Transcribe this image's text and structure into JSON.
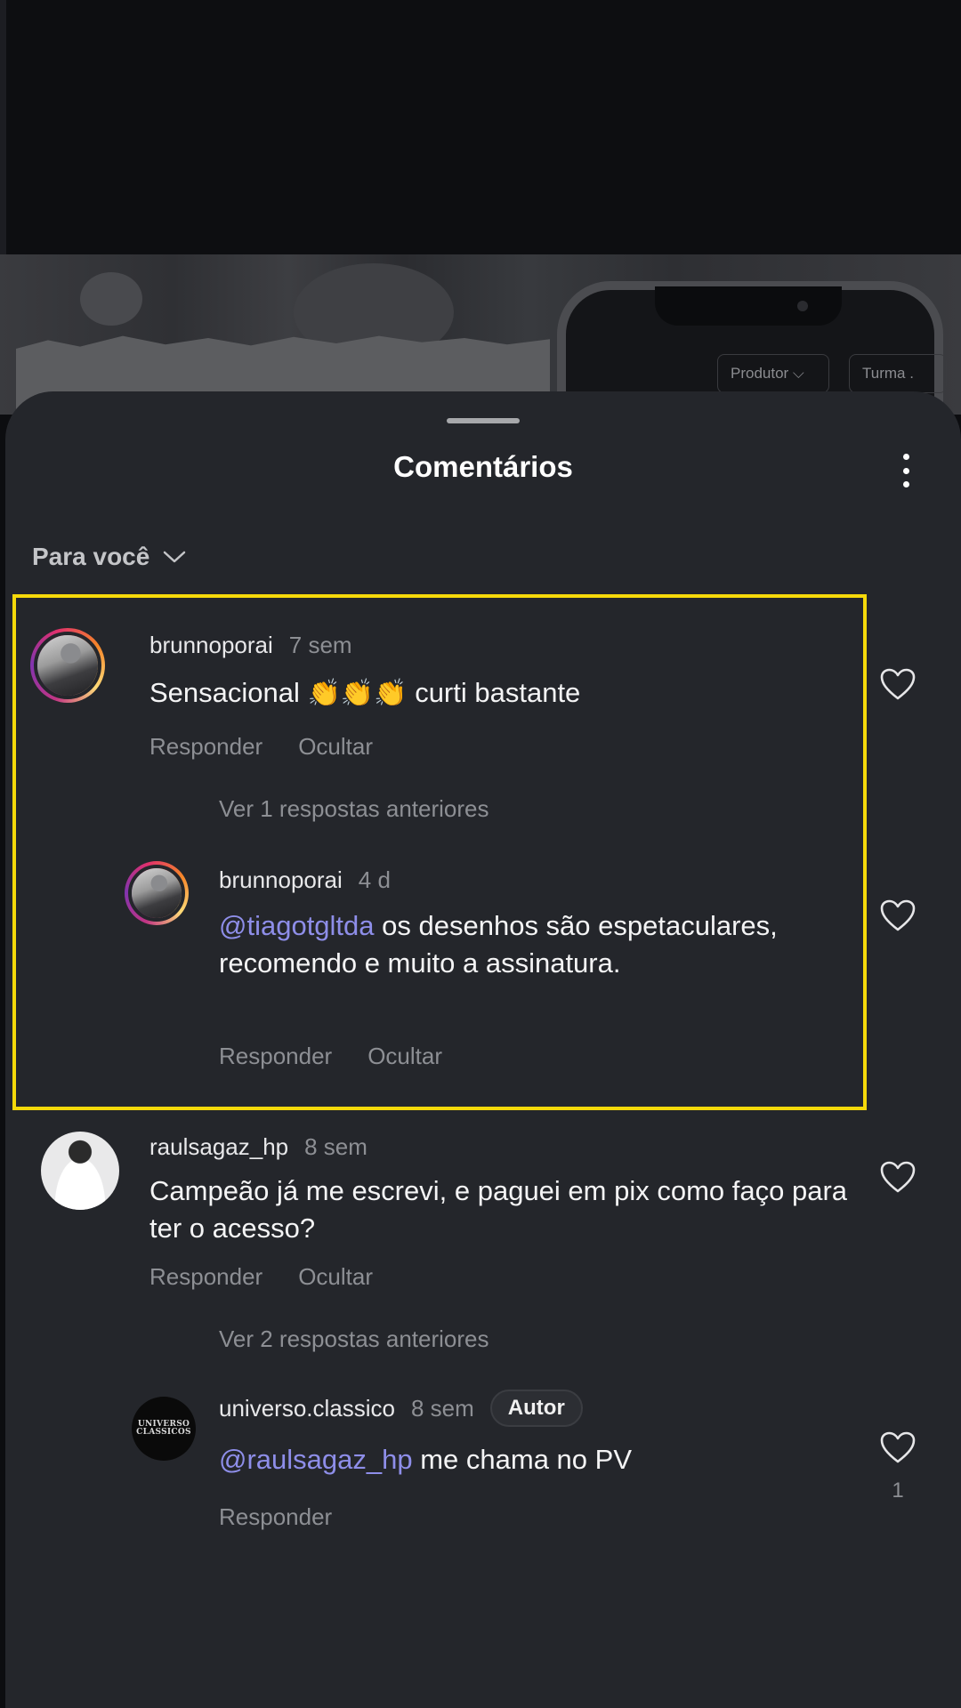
{
  "background": {
    "pill_produtor": "Produtor ⌵",
    "pill_turma": "Turma ."
  },
  "sheet": {
    "title": "Comentários",
    "filter_label": "Para você"
  },
  "comments": [
    {
      "username": "brunnoporai",
      "time": "7 sem",
      "text_before": "Sensacional ",
      "emoji": "👏👏👏",
      "text_after": " curti bastante",
      "reply_label": "Responder",
      "hide_label": "Ocultar",
      "view_replies": "Ver 1 respostas anteriores",
      "reply": {
        "username": "brunnoporai",
        "time": "4 d",
        "mention": "@tiagotgltda",
        "text": " os desenhos são espetaculares, recomendo e muito a assinatura.",
        "reply_label": "Responder",
        "hide_label": "Ocultar"
      }
    },
    {
      "username": "raulsagaz_hp",
      "time": "8 sem",
      "text": "Campeão já me escrevi,  e paguei em pix como faço para ter o acesso?",
      "reply_label": "Responder",
      "hide_label": "Ocultar",
      "view_replies": "Ver 2 respostas anteriores",
      "reply": {
        "username": "universo.classico",
        "time": "8 sem",
        "badge": "Autor",
        "mention": "@raulsagaz_hp",
        "text": " me chama no PV",
        "reply_label": "Responder",
        "like_count": "1",
        "avatar_logo_line1": "UNIVERSO",
        "avatar_logo_line2": "CLASSICOS"
      }
    }
  ],
  "colors": {
    "sheet_bg": "#24262b",
    "highlight": "#f5d90a",
    "mention": "#8e8ee9",
    "muted_text": "#8d8f94"
  },
  "icons": [
    "chevron-down-icon",
    "more-options-icon",
    "heart-icon"
  ]
}
